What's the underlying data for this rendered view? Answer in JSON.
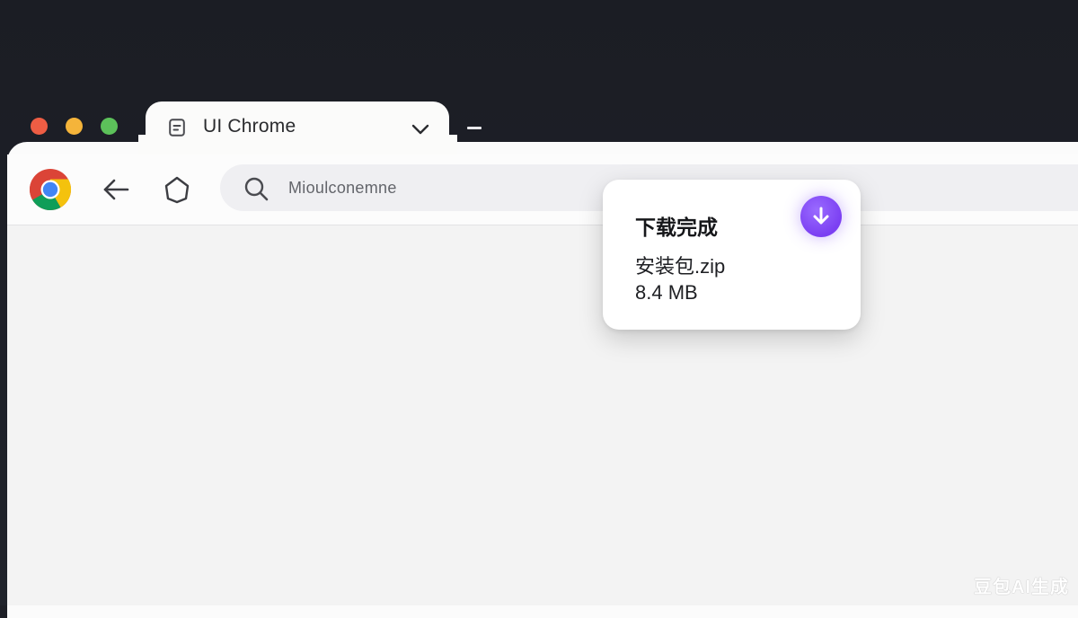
{
  "window": {
    "tab_title": "UI Chrome"
  },
  "toolbar": {
    "address_text": "Mioulconemne"
  },
  "download": {
    "title": "下载完成",
    "file_name": "安装包.zip",
    "file_size": "8.4 MB"
  },
  "watermark": "豆包AI生成",
  "colors": {
    "close": "#ee5d44",
    "minimize": "#f5b43a",
    "maximize": "#5cc15a",
    "accent": "#7b3ff2"
  },
  "icons": {
    "tab_icon": "page-icon",
    "chevron": "chevron-down-icon",
    "logo": "chrome-logo-icon",
    "back": "back-arrow-icon",
    "reload": "reload-icon",
    "search": "search-icon",
    "download": "download-arrow-icon"
  }
}
